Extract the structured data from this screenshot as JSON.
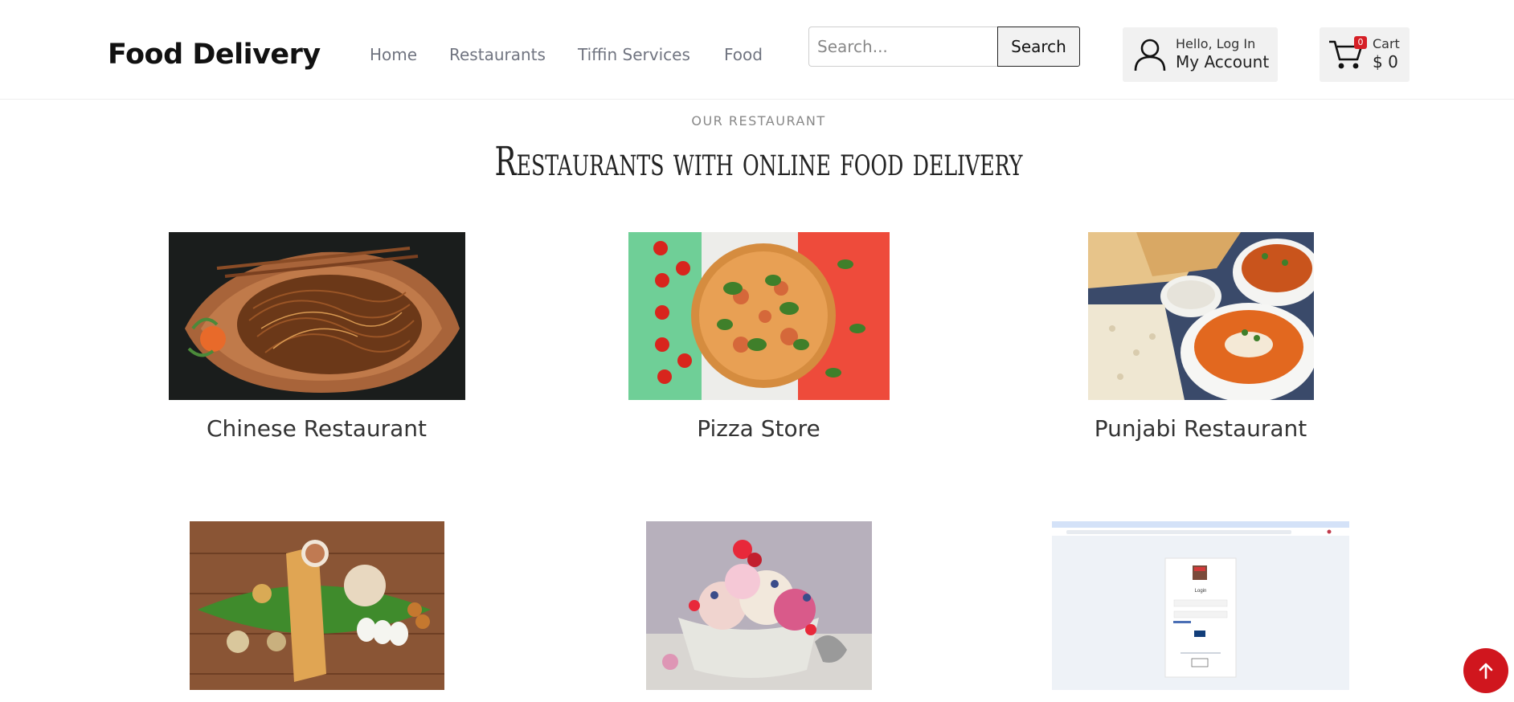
{
  "header": {
    "brand": "Food Delivery",
    "nav": [
      {
        "label": "Home"
      },
      {
        "label": "Restaurants"
      },
      {
        "label": "Tiffin Services"
      },
      {
        "label": "Food"
      }
    ],
    "search": {
      "placeholder": "Search...",
      "value": "",
      "button_label": "Search"
    },
    "account": {
      "greeting": "Hello, Log In",
      "label": "My Account",
      "icon": "user-icon"
    },
    "cart": {
      "label": "Cart",
      "total": "$ 0",
      "count": "0",
      "icon": "cart-icon"
    }
  },
  "section": {
    "eyebrow": "OUR RESTAURANT",
    "title": "Restaurants with online food delivery"
  },
  "restaurants": [
    {
      "name": "Chinese Restaurant"
    },
    {
      "name": "Pizza Store"
    },
    {
      "name": "Punjabi Restaurant"
    },
    {
      "name": ""
    },
    {
      "name": ""
    },
    {
      "name": ""
    }
  ],
  "login_preview": {
    "title": "Login"
  },
  "scroll_top": {
    "icon": "arrow-up-icon"
  },
  "colors": {
    "accent": "#d0161e",
    "nav_text": "#707480",
    "badge": "#d61f26"
  }
}
